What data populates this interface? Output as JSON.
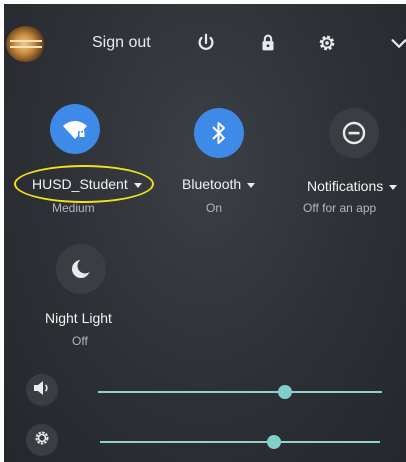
{
  "header": {
    "sign_out_label": "Sign out"
  },
  "tiles": {
    "wifi": {
      "label": "HUSD_Student",
      "status": "Medium",
      "icon": "wifi-lock-icon"
    },
    "bluetooth": {
      "label": "Bluetooth",
      "status": "On",
      "icon": "bluetooth-icon"
    },
    "notifications": {
      "label": "Notifications",
      "status": "Off for an app",
      "icon": "do-not-disturb-icon"
    },
    "night_light": {
      "label": "Night Light",
      "status": "Off",
      "icon": "moon-icon"
    }
  },
  "sliders": {
    "volume": {
      "icon": "speaker-icon",
      "level": 0.66
    },
    "brightness": {
      "icon": "brightness-icon",
      "level": 0.62
    }
  },
  "colors": {
    "accent_blue": "#3d8ae8",
    "slider_teal": "#8fd3cf",
    "annotation_yellow": "#f2e21e"
  }
}
